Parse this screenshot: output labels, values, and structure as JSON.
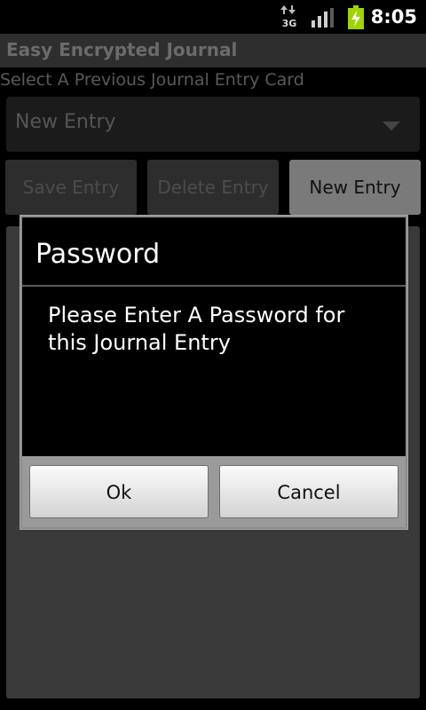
{
  "status": {
    "network": "3G",
    "time": "8:05"
  },
  "app": {
    "title": "Easy Encrypted Journal",
    "prompt_label": "Select A Previous Journal Entry Card",
    "spinner_value": "New Entry",
    "buttons": {
      "save": "Save Entry",
      "delete": "Delete Entry",
      "new": "New Entry"
    }
  },
  "dialog": {
    "title": "Password",
    "message": "Please Enter A Password for this Journal Entry",
    "input_value": "",
    "ok_label": "Ok",
    "cancel_label": "Cancel"
  },
  "colors": {
    "focus": "#f08a00",
    "battery": "#9fd400"
  }
}
